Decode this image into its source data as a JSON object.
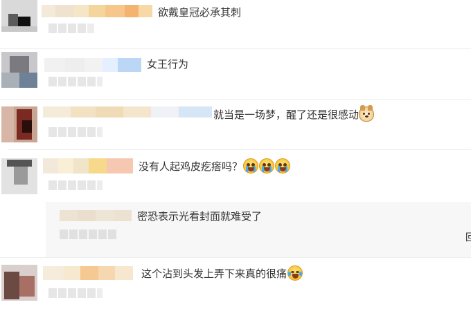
{
  "comments": [
    {
      "text": "欲戴皇冠必承其刺",
      "emojis": []
    },
    {
      "text": "女王行为",
      "emojis": []
    },
    {
      "text": "就当是一场梦，醒了还是很感动",
      "emojis": [
        "doge-icon"
      ]
    },
    {
      "text": "没有人起鸡皮疙瘩吗？",
      "emojis": [
        "crying-face-icon",
        "crying-face-icon",
        "crying-face-icon"
      ]
    },
    {
      "text": "密恐表示光看封面就难受了",
      "emojis": [],
      "is_reply": true
    },
    {
      "text": "这个沾到头发上弄下来真的很痛",
      "emojis": [
        "crying-laugh-icon"
      ]
    }
  ],
  "reply_partial_label": "回",
  "colors": {
    "divider": "#eeeeee",
    "reply_background": "#f7f7f7",
    "text": "#333333",
    "placeholder_gray": "#e6e6e6"
  }
}
